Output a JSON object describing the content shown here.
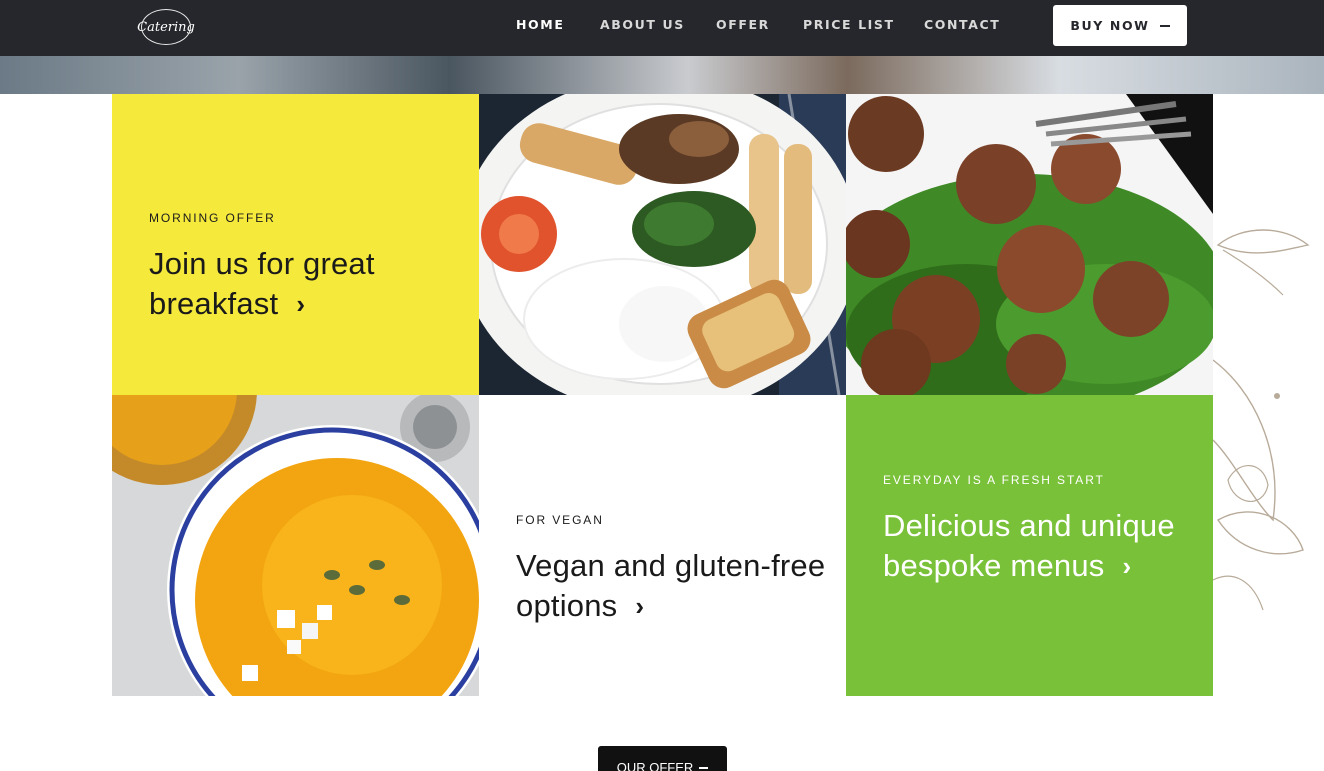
{
  "header": {
    "logo_text": "Catering",
    "nav": [
      "HOME",
      "ABOUT US",
      "OFFER",
      "PRICE LIST",
      "CONTACT"
    ],
    "cta_label": "BUY NOW"
  },
  "tiles": {
    "breakfast": {
      "eyebrow": "MORNING OFFER",
      "title": "Join us for great breakfast"
    },
    "vegan": {
      "eyebrow": "FOR VEGAN",
      "title": "Vegan and gluten-free options"
    },
    "menus": {
      "eyebrow": "EVERYDAY IS A FRESH START",
      "title": "Delicious and unique bespoke menus"
    }
  },
  "photos": [
    "breakfast-plate-photo",
    "meatballs-salad-photo",
    "pumpkin-soup-photo"
  ],
  "cta": {
    "our_offer_label": "OUR OFFER"
  },
  "colors": {
    "header_bg": "#25272c",
    "yellow": "#f5e93c",
    "green": "#7ac13a",
    "dark_button": "#111111"
  }
}
